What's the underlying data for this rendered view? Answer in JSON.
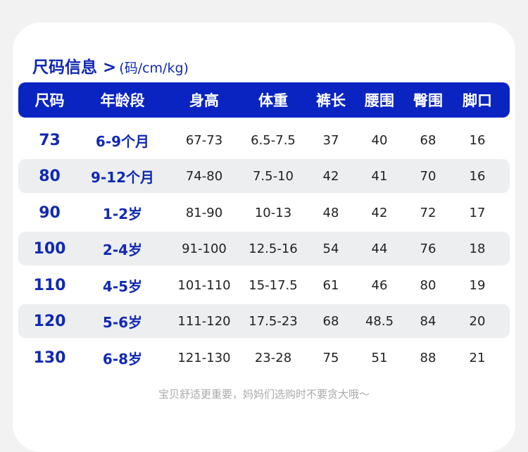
{
  "title": {
    "main": "尺码信息 >",
    "unit": "(码/cm/kg)"
  },
  "headers": [
    "尺码",
    "年龄段",
    "身高",
    "体重",
    "裤长",
    "腰围",
    "臀围",
    "脚口"
  ],
  "rows": [
    {
      "size": "73",
      "age": "6-9个月",
      "height": "67-73",
      "weight": "6.5-7.5",
      "pants_length": "37",
      "waist": "40",
      "hip": "68",
      "cuff": "16"
    },
    {
      "size": "80",
      "age": "9-12个月",
      "height": "74-80",
      "weight": "7.5-10",
      "pants_length": "42",
      "waist": "41",
      "hip": "70",
      "cuff": "16"
    },
    {
      "size": "90",
      "age": "1-2岁",
      "height": "81-90",
      "weight": "10-13",
      "pants_length": "48",
      "waist": "42",
      "hip": "72",
      "cuff": "17"
    },
    {
      "size": "100",
      "age": "2-4岁",
      "height": "91-100",
      "weight": "12.5-16",
      "pants_length": "54",
      "waist": "44",
      "hip": "76",
      "cuff": "18"
    },
    {
      "size": "110",
      "age": "4-5岁",
      "height": "101-110",
      "weight": "15-17.5",
      "pants_length": "61",
      "waist": "46",
      "hip": "80",
      "cuff": "19"
    },
    {
      "size": "120",
      "age": "5-6岁",
      "height": "111-120",
      "weight": "17.5-23",
      "pants_length": "68",
      "waist": "48.5",
      "hip": "84",
      "cuff": "20"
    },
    {
      "size": "130",
      "age": "6-8岁",
      "height": "121-130",
      "weight": "23-28",
      "pants_length": "75",
      "waist": "51",
      "hip": "88",
      "cuff": "21"
    }
  ],
  "footnote": "宝贝舒适更重要，妈妈们选购时不要贪大哦～",
  "colors": {
    "accent": "#0a24c2",
    "accent_text": "#1129b2",
    "row_shade": "#eceef0",
    "page_bg": "#f2f2f2",
    "footnote": "#aaaaaa"
  }
}
